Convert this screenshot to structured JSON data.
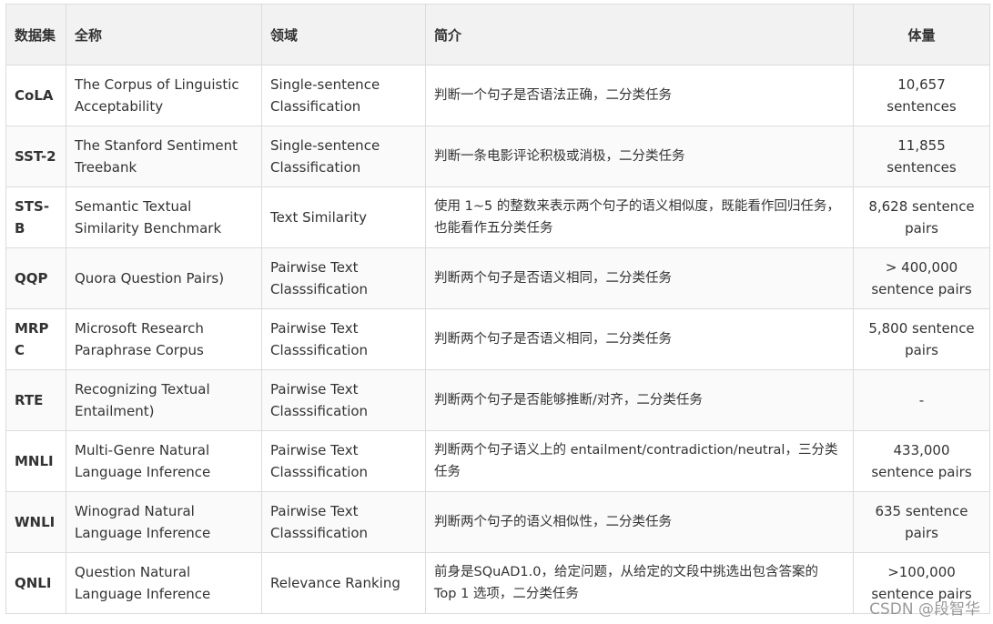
{
  "header": {
    "abbr": "数据集",
    "full_name": "全称",
    "domain": "领域",
    "description": "简介",
    "size": "体量"
  },
  "rows": [
    {
      "abbr": "CoLA",
      "full_name": "The Corpus of Linguistic Acceptability",
      "domain": "Single-sentence Classification",
      "description": "判断一个句子是否语法正确，二分类任务",
      "size": "10,657 sentences"
    },
    {
      "abbr": "SST-2",
      "full_name": "The Stanford Sentiment Treebank",
      "domain": "Single-sentence Classification",
      "description": "判断一条电影评论积极或消极，二分类任务",
      "size": "11,855 sentences"
    },
    {
      "abbr": "STS-B",
      "full_name": "Semantic Textual Similarity Benchmark",
      "domain": "Text Similarity",
      "description": "使用 1~5 的整数来表示两个句子的语义相似度，既能看作回归任务，也能看作五分类任务",
      "size": "8,628 sentence pairs"
    },
    {
      "abbr": "QQP",
      "full_name": "Quora Question Pairs)",
      "domain": "Pairwise Text Classsification",
      "description": "判断两个句子是否语义相同，二分类任务",
      "size": "> 400,000 sentence pairs"
    },
    {
      "abbr": "MRPC",
      "full_name": "Microsoft Research Paraphrase Corpus",
      "domain": "Pairwise Text Classsification",
      "description": "判断两个句子是否语义相同，二分类任务",
      "size": "5,800 sentence pairs"
    },
    {
      "abbr": "RTE",
      "full_name": "Recognizing Textual Entailment)",
      "domain": "Pairwise Text Classsification",
      "description": "判断两个句子是否能够推断/对齐，二分类任务",
      "size": "-"
    },
    {
      "abbr": "MNLI",
      "full_name": "Multi-Genre Natural Language Inference",
      "domain": "Pairwise Text Classsification",
      "description": "判断两个句子语义上的 entailment/contradiction/neutral，三分类任务",
      "size": "433,000 sentence pairs"
    },
    {
      "abbr": "WNLI",
      "full_name": "Winograd Natural Language Inference",
      "domain": "Pairwise Text Classsification",
      "description": "判断两个句子的语义相似性，二分类任务",
      "size": "635 sentence pairs"
    },
    {
      "abbr": "QNLI",
      "full_name": "Question Natural Language Inference",
      "domain": "Relevance Ranking",
      "description": "前身是SQuAD1.0，给定问题，从给定的文段中挑选出包含答案的 Top 1 选项，二分类任务",
      "size": ">100,000 sentence pairs"
    }
  ],
  "watermark": "CSDN @段智华"
}
